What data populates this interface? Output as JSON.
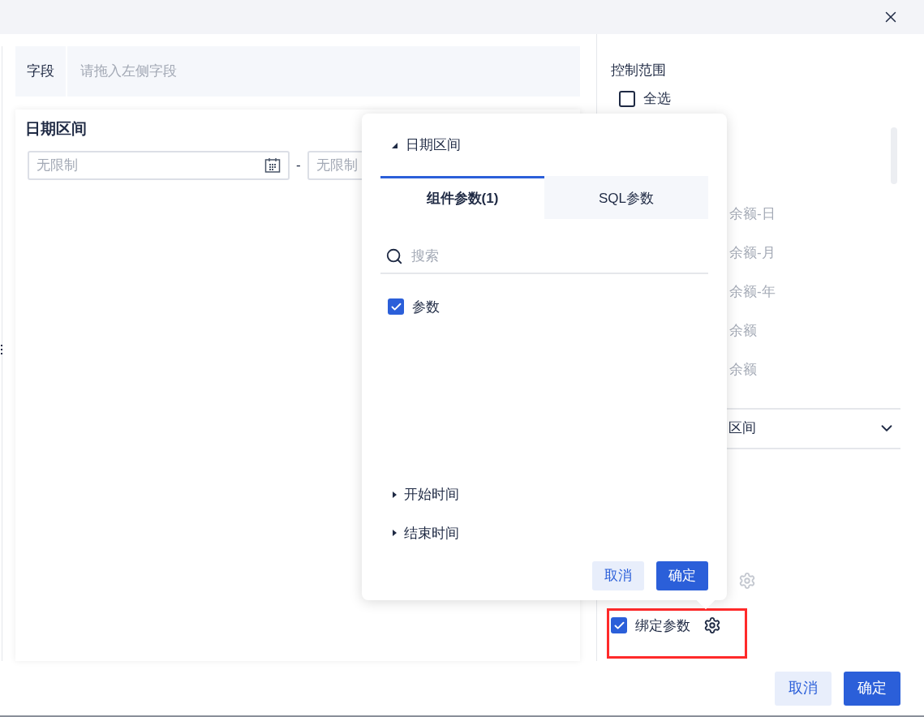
{
  "field": {
    "label": "字段",
    "placeholder": "请拖入左侧字段"
  },
  "widget": {
    "title": "日期区间",
    "start": {
      "placeholder": "无限制"
    },
    "separator": "-",
    "end": {
      "placeholder": "无限制"
    }
  },
  "right_panel": {
    "title": "控制范围",
    "select_all": {
      "label": "全选",
      "checked": false
    },
    "items": [
      "余额-日",
      "余额-月",
      "余额-年",
      "余额",
      "余额"
    ],
    "dropdown": {
      "value": "区间"
    },
    "bind_param": {
      "label": "绑定参数",
      "checked": true
    }
  },
  "popup": {
    "title": "日期区间",
    "expanded": true,
    "tabs": [
      {
        "label": "组件参数(1)",
        "selected": true
      },
      {
        "label": "SQL参数",
        "selected": false
      }
    ],
    "search": {
      "placeholder": "搜索"
    },
    "params": [
      {
        "label": "参数",
        "checked": true
      }
    ],
    "groups": [
      {
        "label": "开始时间",
        "expanded": false
      },
      {
        "label": "结束时间",
        "expanded": false
      }
    ],
    "buttons": [
      {
        "label": "取消",
        "kind": "secondary"
      },
      {
        "label": "确定",
        "kind": "primary"
      }
    ]
  },
  "footer": {
    "buttons": [
      {
        "label": "取消",
        "kind": "secondary"
      },
      {
        "label": "确定",
        "kind": "primary"
      }
    ]
  }
}
